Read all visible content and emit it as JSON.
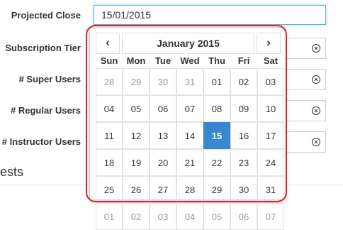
{
  "form": {
    "projected_close_label": "Projected Close",
    "projected_close_value": "15/01/2015",
    "subscription_tier_label": "Subscription Tier",
    "super_users_label": "# Super Users",
    "regular_users_label": "# Regular Users",
    "instructor_users_label": "# Instructor Users"
  },
  "section_fragment": "ests",
  "datepicker": {
    "month_title": "January 2015",
    "prev_icon": "‹",
    "next_icon": "›",
    "weekdays": [
      "Sun",
      "Mon",
      "Tue",
      "Wed",
      "Thu",
      "Fri",
      "Sat"
    ],
    "weeks": [
      [
        {
          "d": "28",
          "m": true
        },
        {
          "d": "29",
          "m": true
        },
        {
          "d": "30",
          "m": true
        },
        {
          "d": "31",
          "m": true
        },
        {
          "d": "01"
        },
        {
          "d": "02"
        },
        {
          "d": "03"
        }
      ],
      [
        {
          "d": "04"
        },
        {
          "d": "05"
        },
        {
          "d": "06"
        },
        {
          "d": "07"
        },
        {
          "d": "08"
        },
        {
          "d": "09"
        },
        {
          "d": "10"
        }
      ],
      [
        {
          "d": "11"
        },
        {
          "d": "12"
        },
        {
          "d": "13"
        },
        {
          "d": "14"
        },
        {
          "d": "15",
          "s": true
        },
        {
          "d": "16"
        },
        {
          "d": "17"
        }
      ],
      [
        {
          "d": "18"
        },
        {
          "d": "19"
        },
        {
          "d": "20"
        },
        {
          "d": "21"
        },
        {
          "d": "22"
        },
        {
          "d": "23"
        },
        {
          "d": "24"
        }
      ],
      [
        {
          "d": "25"
        },
        {
          "d": "26"
        },
        {
          "d": "27"
        },
        {
          "d": "28"
        },
        {
          "d": "29"
        },
        {
          "d": "30"
        },
        {
          "d": "31"
        }
      ],
      [
        {
          "d": "01",
          "m": true
        },
        {
          "d": "02",
          "m": true
        },
        {
          "d": "03",
          "m": true
        },
        {
          "d": "04",
          "m": true
        },
        {
          "d": "05",
          "m": true
        },
        {
          "d": "06",
          "m": true
        },
        {
          "d": "07",
          "m": true
        }
      ]
    ]
  },
  "icons": {
    "clear": "clear-circle-icon"
  },
  "colors": {
    "selected_day": "#3a87d0",
    "highlight_ring": "#e02020",
    "focus_border": "#66afe9"
  }
}
